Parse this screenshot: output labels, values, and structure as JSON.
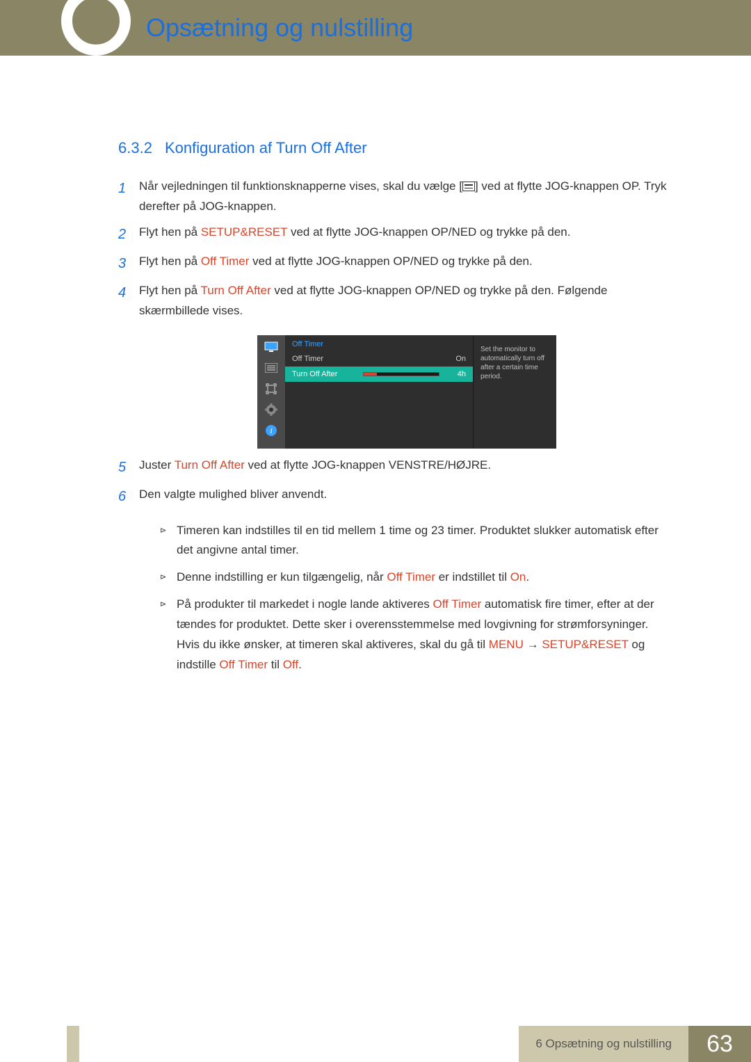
{
  "header": {
    "title": "Opsætning og nulstilling"
  },
  "section": {
    "number": "6.3.2",
    "title": "Konfiguration af Turn Off After"
  },
  "steps": [
    {
      "n": "1",
      "pre": "Når vejledningen til funktionsknapperne vises, skal du vælge [",
      "post": "] ved at flytte JOG-knappen OP. Tryk derefter på JOG-knappen."
    },
    {
      "n": "2",
      "a": "Flyt hen på ",
      "hl": "SETUP&RESET",
      "b": " ved at flytte JOG-knappen OP/NED og trykke på den."
    },
    {
      "n": "3",
      "a": "Flyt hen på ",
      "hl": "Off Timer",
      "b": " ved at flytte JOG-knappen OP/NED og trykke på den."
    },
    {
      "n": "4",
      "a": "Flyt hen på ",
      "hl": "Turn Off After",
      "b": " ved at flytte JOG-knappen OP/NED og trykke på den. Følgende skærmbillede vises."
    },
    {
      "n": "5",
      "a": "Juster ",
      "hl": "Turn Off After",
      "b": " ved at flytte JOG-knappen VENSTRE/HØJRE."
    },
    {
      "n": "6",
      "plain": "Den valgte mulighed bliver anvendt."
    }
  ],
  "osd": {
    "title": "Off Timer",
    "row1": {
      "label": "Off Timer",
      "value": "On"
    },
    "row2": {
      "label": "Turn Off After",
      "value": "4h"
    },
    "desc": "Set the monitor to automatically turn off after a certain time period."
  },
  "notes": [
    {
      "text": "Timeren kan indstilles til en tid mellem 1 time og 23 timer. Produktet slukker automatisk efter det angivne antal timer."
    },
    {
      "parts": [
        {
          "t": "Denne indstilling er kun tilgængelig, når "
        },
        {
          "t": "Off Timer",
          "hl": true
        },
        {
          "t": " er indstillet til "
        },
        {
          "t": "On",
          "hl": true
        },
        {
          "t": "."
        }
      ]
    },
    {
      "parts": [
        {
          "t": "På produkter til markedet i nogle lande aktiveres "
        },
        {
          "t": "Off Timer",
          "hl": true
        },
        {
          "t": " automatisk fire timer, efter at der tændes for produktet. Dette sker i overensstemmelse med lovgivning for strømforsyninger. Hvis du ikke ønsker, at timeren skal aktiveres, skal du gå til "
        },
        {
          "t": "MENU",
          "hl": true
        },
        {
          "t": " → "
        },
        {
          "t": "SETUP&RESET",
          "hl": true
        },
        {
          "t": " og indstille "
        },
        {
          "t": "Off Timer",
          "hl": true
        },
        {
          "t": " til "
        },
        {
          "t": "Off",
          "hl": true
        },
        {
          "t": "."
        }
      ]
    }
  ],
  "footer": {
    "chapter": "6 Opsætning og nulstilling",
    "page": "63"
  }
}
